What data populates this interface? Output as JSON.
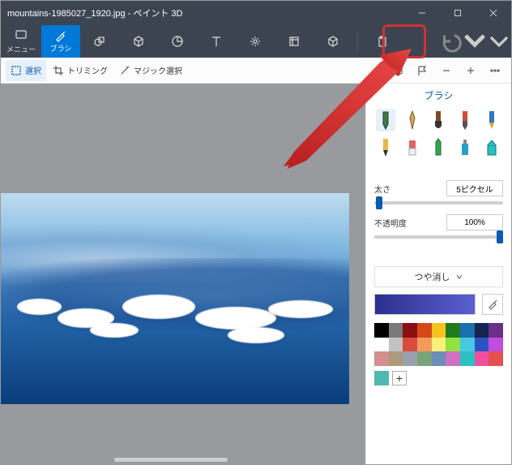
{
  "title": "mountains-1985027_1920.jpg - ペイント 3D",
  "menu_label": "メニュー",
  "tabs": {
    "brush": "ブラシ"
  },
  "sec": {
    "select": "選択",
    "trimming": "トリミング",
    "magic": "マジック選択"
  },
  "panel": {
    "title": "ブラシ",
    "thickness_label": "太さ",
    "thickness_value": "5ピクセル",
    "opacity_label": "不透明度",
    "opacity_value": "100%",
    "finish_label": "つや消し"
  },
  "palette": [
    "#000000",
    "#7a7a7a",
    "#8a0f12",
    "#d34817",
    "#f6c21b",
    "#1e7a1e",
    "#1a6fae",
    "#17244f",
    "#6a2f87",
    "#ffffff",
    "#c2c2c2",
    "#d94b3d",
    "#f49a5f",
    "#faf07a",
    "#8fe23f",
    "#47c7e0",
    "#2a54c4",
    "#c24de0",
    "#d48f8f",
    "#ad9a7a",
    "#9aa0ad",
    "#7aa37a",
    "#6a8fb8",
    "#d070c0",
    "#2cc0c0",
    "#f04f9f",
    "#e64f4f"
  ],
  "add_symbol": "+"
}
